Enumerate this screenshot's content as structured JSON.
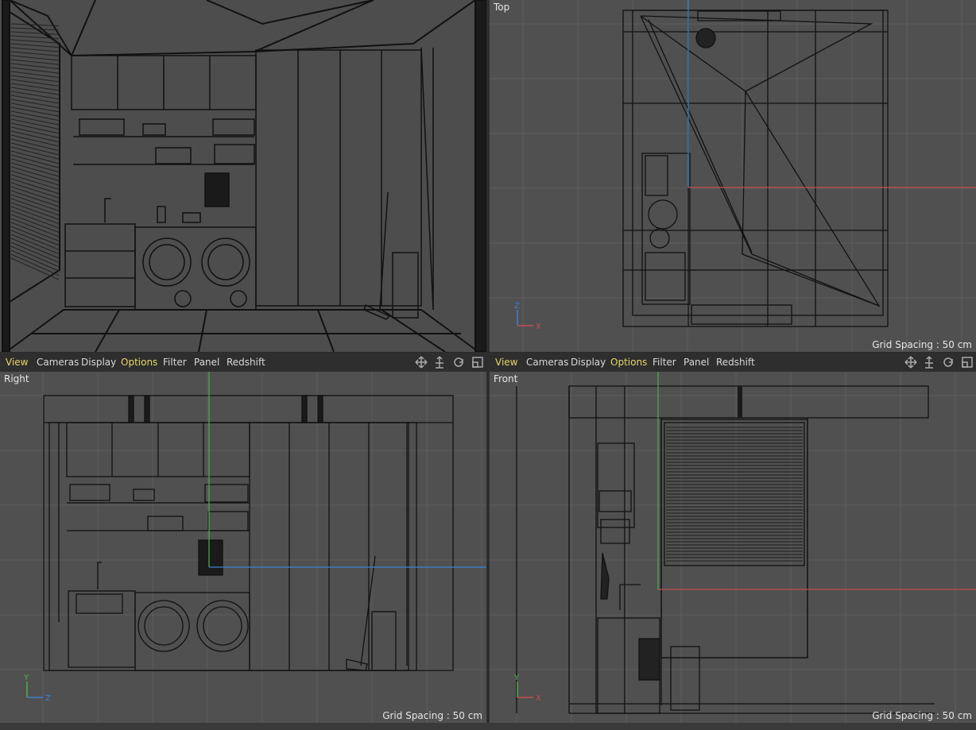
{
  "viewports": {
    "perspective": {
      "label": ""
    },
    "top": {
      "label": "Top",
      "grid": "Grid Spacing : 50 cm"
    },
    "right": {
      "label": "Right",
      "grid": "Grid Spacing : 50 cm"
    },
    "front": {
      "label": "Front",
      "grid": "Grid Spacing : 50 cm"
    }
  },
  "menus": {
    "left": [
      "View",
      "Cameras",
      "Display",
      "Options",
      "Filter",
      "Panel",
      "Redshift"
    ],
    "right": [
      "View",
      "Cameras",
      "Display",
      "Options",
      "Filter",
      "Panel",
      "Redshift"
    ]
  },
  "axis_labels": {
    "top": [
      "Z",
      "X"
    ],
    "right": [
      "Y",
      "Z"
    ],
    "front": [
      "Y",
      "X"
    ]
  },
  "colors": {
    "viewport_bg": "#505050",
    "grid": "#5c5c5c",
    "wire": "#111111",
    "axis_x": "#c0504d",
    "axis_y": "#4caf50",
    "axis_z": "#3d7fd0",
    "menu_highlight": "#e6d66a"
  },
  "icons": [
    "move-view-icon",
    "zoom-view-icon",
    "rotate-view-icon",
    "maximize-view-icon"
  ]
}
